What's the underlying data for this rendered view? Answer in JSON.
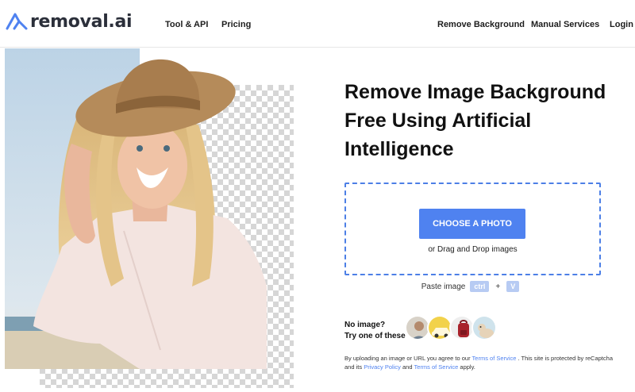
{
  "brand": {
    "logo_text": "removal.ai",
    "accent": "#4f82f0"
  },
  "nav": {
    "tool_api": "Tool & API",
    "pricing": "Pricing",
    "remove_background": "Remove Background",
    "manual_services": "Manual Services",
    "login": "Login"
  },
  "hero": {
    "headline": "Remove Image Background Free Using Artificial Intelligence"
  },
  "upload": {
    "choose_label": "CHOOSE A PHOTO",
    "drag_text": "or Drag and Drop images",
    "paste_label": "Paste image",
    "key_ctrl": "ctrl",
    "key_plus": "+",
    "key_v": "V"
  },
  "samples": {
    "no_image": "No image?",
    "try_one": "Try one of these",
    "items": [
      "man-photo",
      "car-photo",
      "backpack-photo",
      "dog-photo"
    ]
  },
  "terms": {
    "prefix": "By uploading an image or URL you agree to our",
    "tos": "Terms of Service",
    "middle": ". This site is protected by reCaptcha and its",
    "privacy": "Privacy Policy",
    "and": "and",
    "tos2": "Terms of Service",
    "suffix": "apply."
  }
}
